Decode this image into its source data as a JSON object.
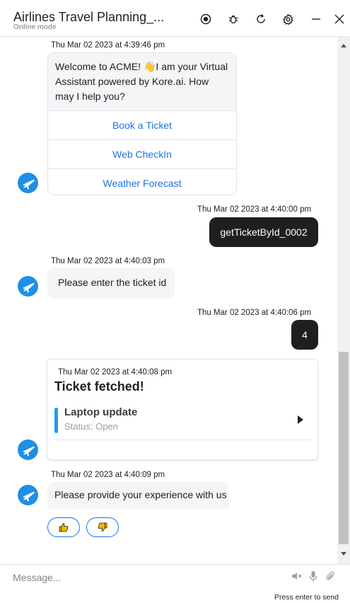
{
  "header": {
    "title": "Airlines Travel Planning_...",
    "subtitle": "Online mode"
  },
  "messages": {
    "welcome": {
      "timestamp": "Thu Mar 02 2023 at 4:39:46 pm",
      "text": "Welcome to ACME! 👋I am your Virtual Assistant powered by Kore.ai. How may I help you?",
      "options": [
        "Book a Ticket",
        "Web CheckIn",
        "Weather Forecast"
      ]
    },
    "user1": {
      "timestamp": "Thu Mar 02 2023 at 4:40:00 pm",
      "text": "getTicketById_0002"
    },
    "bot2": {
      "timestamp": "Thu Mar 02 2023 at 4:40:03 pm",
      "text": "Please enter the ticket id"
    },
    "user2": {
      "timestamp": "Thu Mar 02 2023 at 4:40:06 pm",
      "text": "4"
    },
    "ticket": {
      "timestamp": "Thu Mar 02 2023 at 4:40:08 pm",
      "title": "Ticket fetched!",
      "item_title": "Laptop update",
      "item_status": "Status: Open"
    },
    "feedback": {
      "timestamp": "Thu Mar 02 2023 at 4:40:09 pm",
      "text": "Please provide your experience with us"
    }
  },
  "composer": {
    "placeholder": "Message...",
    "hint": "Press enter to send"
  },
  "colors": {
    "accent": "#1a73e8",
    "avatar": "#1f8fe6",
    "user_bubble": "#1e1f21",
    "ticket_bar": "#1d9bf0"
  },
  "icons": [
    "record-icon",
    "bug-icon",
    "refresh-icon",
    "settings-icon",
    "minimize-icon",
    "close-icon",
    "bot-avatar-icon",
    "thumbs-up-icon",
    "thumbs-down-icon",
    "speaker-off-icon",
    "microphone-icon",
    "attachment-icon"
  ]
}
